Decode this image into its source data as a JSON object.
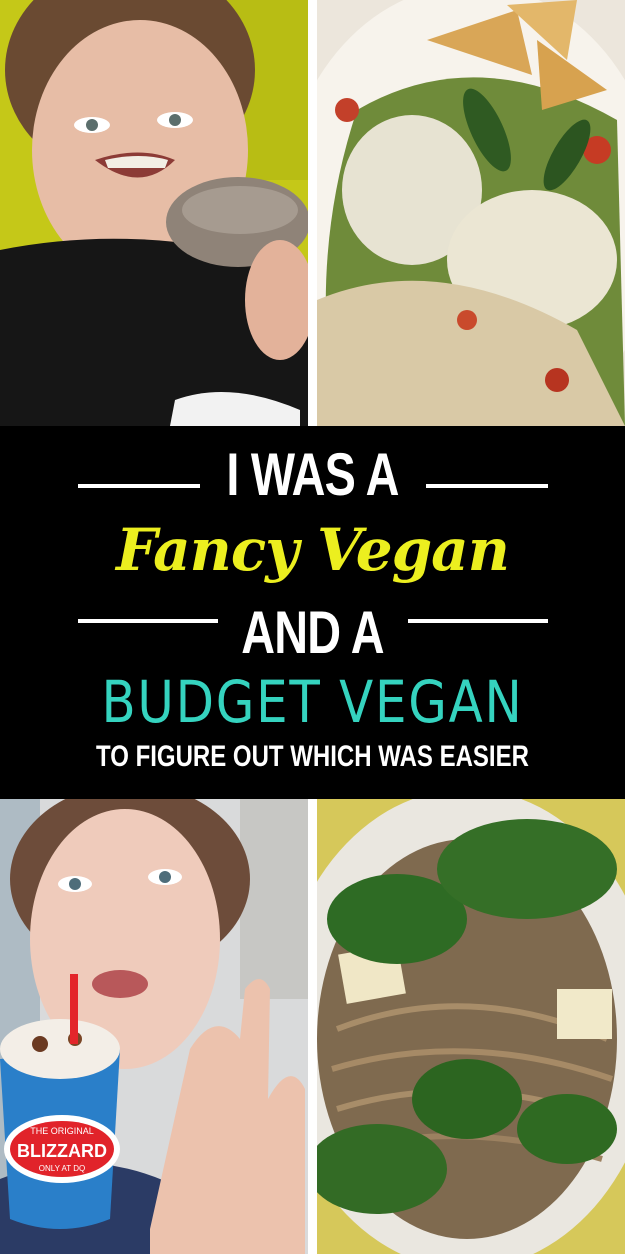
{
  "headline": {
    "line1": "I WAS A",
    "line2": "Fancy Vegan",
    "line3": "AND A",
    "line4": "BUDGET VEGAN",
    "line5": "TO FIGURE OUT WHICH WAS EASIER"
  },
  "photos": {
    "blizzard_cup": {
      "brand": "BLIZZARD",
      "top_text": "THE ORIGINAL",
      "bottom_text": "ONLY AT DQ"
    }
  },
  "colors": {
    "banner": "#000000",
    "fancy": "#ecef1f",
    "budget": "#35d3bf",
    "white_text": "#ffffff"
  }
}
